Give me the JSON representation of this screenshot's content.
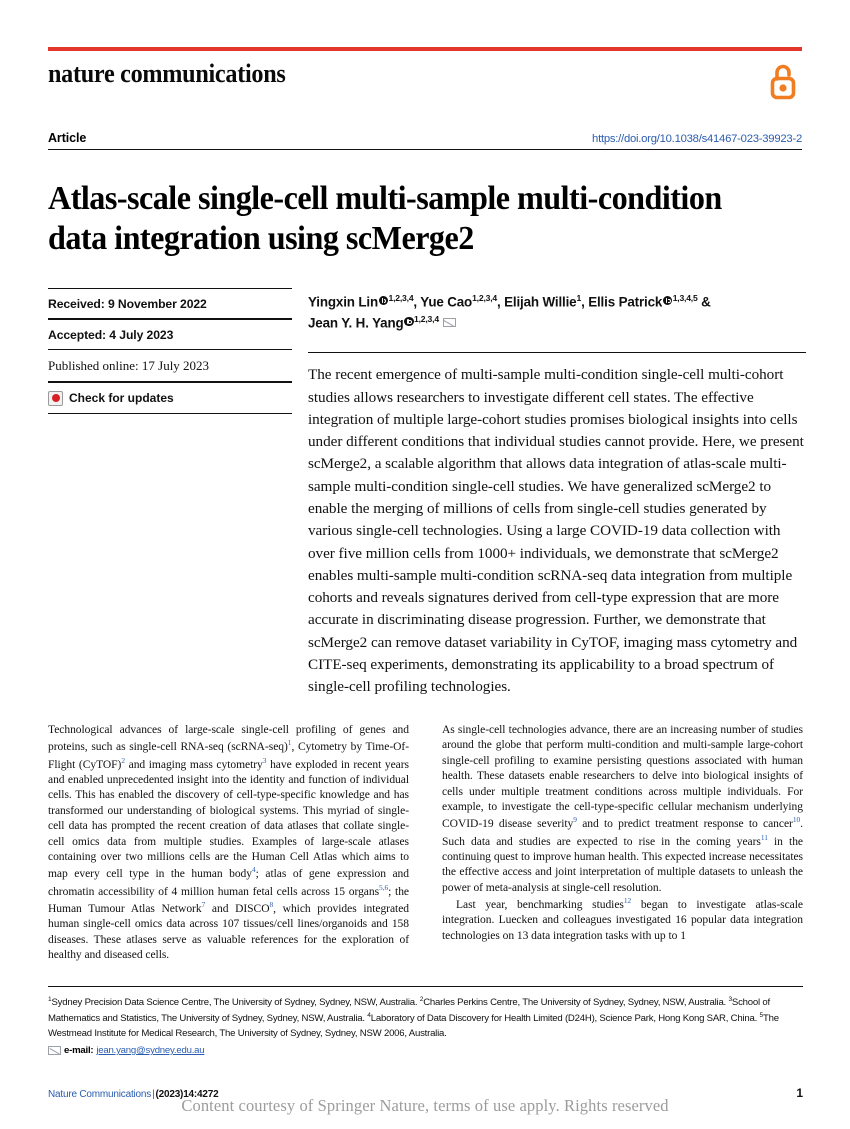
{
  "masthead": {
    "journal": "nature communications",
    "open_access_icon": "open-access-lock-icon",
    "rule_color": "#e4352c"
  },
  "article_bar": {
    "label": "Article",
    "doi": "https://doi.org/10.1038/s41467-023-39923-2",
    "doi_color": "#2a5db0"
  },
  "title": "Atlas-scale single-cell multi-sample multi-condition data integration using scMerge2",
  "metadata": {
    "received": "Received: 9 November 2022",
    "accepted": "Accepted: 4 July 2023",
    "published": "Published online: 17 July 2023",
    "check_for_updates": "Check for updates"
  },
  "authors": {
    "line1_a": "Yingxin Lin",
    "line1_a_sup": "1,2,3,4",
    "line1_b": ", Yue Cao",
    "line1_b_sup": "1,2,3,4",
    "line1_c": ", Elijah Willie",
    "line1_c_sup": "1",
    "line1_d": ", Ellis Patrick",
    "line1_d_sup": "1,3,4,5",
    "line1_e": " &",
    "line2_a": "Jean Y. H. Yang",
    "line2_a_sup": "1,2,3,4"
  },
  "abstract": "The recent emergence of multi-sample multi-condition single-cell multi-cohort studies allows researchers to investigate different cell states. The effective integration of multiple large-cohort studies promises biological insights into cells under different conditions that individual studies cannot provide. Here, we present scMerge2, a scalable algorithm that allows data integration of atlas-scale multi-sample multi-condition single-cell studies. We have generalized scMerge2 to enable the merging of millions of cells from single-cell studies generated by various single-cell technologies. Using a large COVID-19 data collection with over five million cells from 1000+ individuals, we demonstrate that scMerge2 enables multi-sample multi-condition scRNA-seq data integration from multiple cohorts and reveals signatures derived from cell-type expression that are more accurate in discriminating disease progression. Further, we demonstrate that scMerge2 can remove dataset variability in CyTOF, imaging mass cytometry and CITE-seq experiments, demonstrating its applicability to a broad spectrum of single-cell profiling technologies.",
  "body": {
    "left_col": [
      {
        "segments": [
          {
            "t": "Technological advances of large-scale single-cell profiling of genes and proteins, such as single-cell RNA-seq (scRNA-seq)"
          },
          {
            "sup": "1"
          },
          {
            "t": ", Cytometry by Time-Of-Flight (CyTOF)"
          },
          {
            "sup": "2"
          },
          {
            "t": " and imaging mass cytometry"
          },
          {
            "sup": "3"
          },
          {
            "t": " have exploded in recent years and enabled unprecedented insight into the identity and function of individual cells. This has enabled the discovery of cell-type-specific knowledge and has transformed our understanding of biological systems. This myriad of single-cell data has prompted the recent creation of data atlases that collate single-cell omics data from multiple studies. Examples of large-scale atlases containing over two millions cells are the Human Cell Atlas which aims to map every cell type in the human body"
          },
          {
            "sup": "4"
          },
          {
            "t": "; atlas of gene expression and chromatin accessibility of 4 million human fetal cells across 15 organs"
          },
          {
            "sup": "5,6"
          },
          {
            "t": "; the Human Tumour Atlas Network"
          },
          {
            "sup": "7"
          },
          {
            "t": " and DISCO"
          },
          {
            "sup": "8"
          },
          {
            "t": ", which provides integrated human single-cell omics data across 107 tissues/cell lines/organoids and 158 diseases. These atlases serve as valuable references for the exploration of healthy and diseased cells."
          }
        ]
      }
    ],
    "right_col": [
      {
        "segments": [
          {
            "t": "As single-cell technologies advance, there are an increasing number of studies around the globe that perform multi-condition and multi-sample large-cohort single-cell profiling to examine persisting questions associated with human health. These datasets enable researchers to delve into biological insights of cells under multiple treatment conditions across multiple individuals. For example, to investigate the cell-type-specific cellular mechanism underlying COVID-19 disease severity"
          },
          {
            "sup": "9"
          },
          {
            "t": " and to predict treatment response to cancer"
          },
          {
            "sup": "10"
          },
          {
            "t": ". Such data and studies are expected to rise in the coming years"
          },
          {
            "sup": "11"
          },
          {
            "t": " in the continuing quest to improve human health. This expected increase necessitates the effective access and joint interpretation of multiple datasets to unleash the power of meta-analysis at single-cell resolution."
          }
        ],
        "indent": false
      },
      {
        "segments": [
          {
            "t": "Last year, benchmarking studies"
          },
          {
            "sup": "12"
          },
          {
            "t": " began to investigate atlas-scale integration. Luecken and colleagues investigated 16 popular data integration technologies on 13 data integration tasks with up to 1"
          }
        ],
        "indent": true
      }
    ]
  },
  "affiliations": {
    "segments": [
      {
        "sup": "1"
      },
      {
        "t": "Sydney Precision Data Science Centre, The University of Sydney, Sydney, NSW, Australia. "
      },
      {
        "sup": "2"
      },
      {
        "t": "Charles Perkins Centre, The University of Sydney, Sydney, NSW, Australia. "
      },
      {
        "sup": "3"
      },
      {
        "t": "School of Mathematics and Statistics, The University of Sydney, Sydney, NSW, Australia. "
      },
      {
        "sup": "4"
      },
      {
        "t": "Laboratory of Data Discovery for Health Limited (D24H), Science Park, Hong Kong SAR, China. "
      },
      {
        "sup": "5"
      },
      {
        "t": "The Westmead Institute for Medical Research, The University of Sydney, Sydney, NSW 2006, Australia."
      }
    ],
    "email_label": "e-mail:",
    "email_address": "jean.yang@sydney.edu.au"
  },
  "footer": {
    "journal": "Nature Communications",
    "separator": "|",
    "citation": "(2023)14:4272",
    "page_number": "1",
    "watermark": "Content courtesy of Springer Nature, terms of use apply. Rights reserved"
  }
}
